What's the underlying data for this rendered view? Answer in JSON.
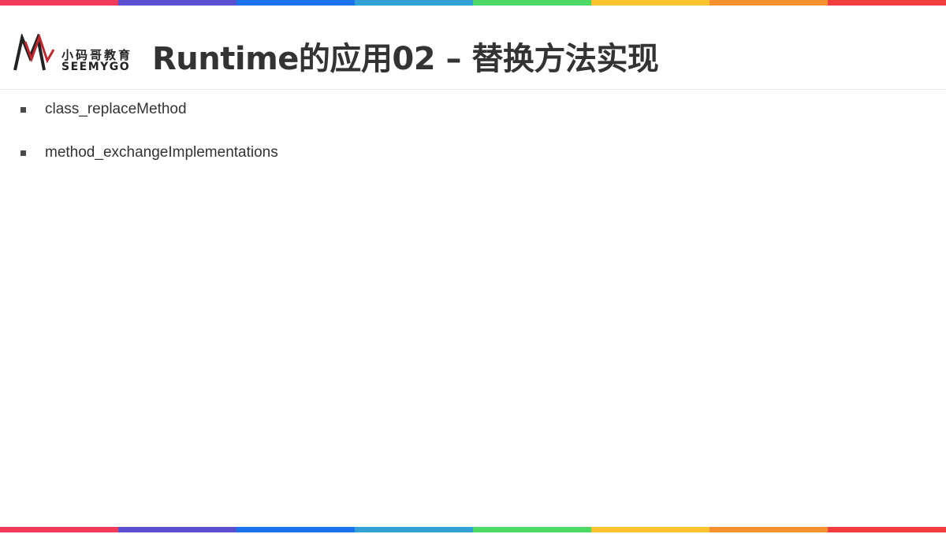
{
  "stripe_colors": [
    "#f23a5b",
    "#5a4fcf",
    "#1a73e8",
    "#34a0d8",
    "#4cd964",
    "#fbc32d",
    "#f5922f",
    "#f03e3e"
  ],
  "logo": {
    "cn": "小码哥教育",
    "en": "SEEMYGO",
    "mark_colors": [
      "#222222",
      "#c0272d"
    ]
  },
  "title": "Runtime的应用02 – 替换方法实现",
  "bullets": [
    {
      "text": "class_replaceMethod"
    },
    {
      "text": "method_exchangeImplementations"
    }
  ]
}
